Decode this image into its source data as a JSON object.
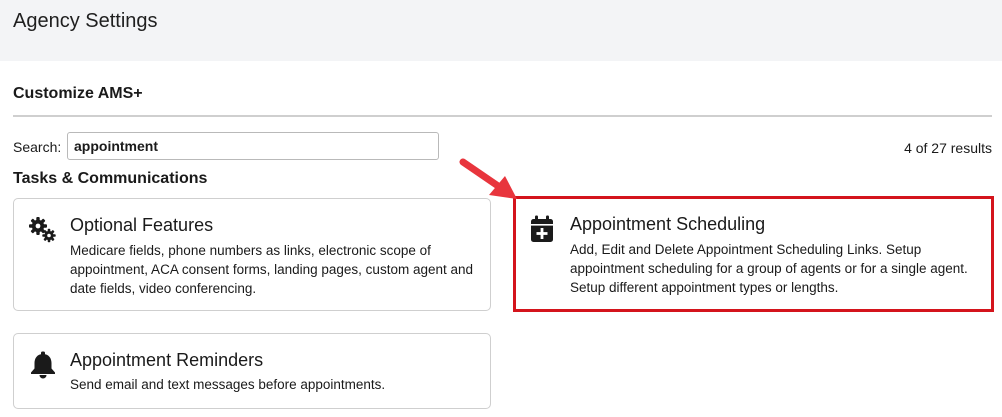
{
  "header": {
    "title": "Agency Settings"
  },
  "section": {
    "title": "Customize AMS+"
  },
  "search": {
    "label": "Search:",
    "value": "appointment",
    "results": "4 of 27 results"
  },
  "group": {
    "title": "Tasks & Communications"
  },
  "cards": [
    {
      "icon": "gears-icon",
      "title": "Optional Features",
      "description": "Medicare fields, phone numbers as links, electronic scope of appointment, ACA consent forms, landing pages, custom agent and date fields, video conferencing."
    },
    {
      "icon": "calendar-plus-icon",
      "title": "Appointment Scheduling",
      "description": "Add, Edit and Delete Appointment Scheduling Links. Setup appointment scheduling for a group of agents or for a single agent. Setup different appointment types or lengths."
    },
    {
      "icon": "bell-icon",
      "title": "Appointment Reminders",
      "description": "Send email and text messages before appointments."
    }
  ],
  "annotation": {
    "highlight_color": "#d4141c",
    "arrow_color": "#e8353d",
    "arrow_icon": "arrow-down-right-icon"
  }
}
